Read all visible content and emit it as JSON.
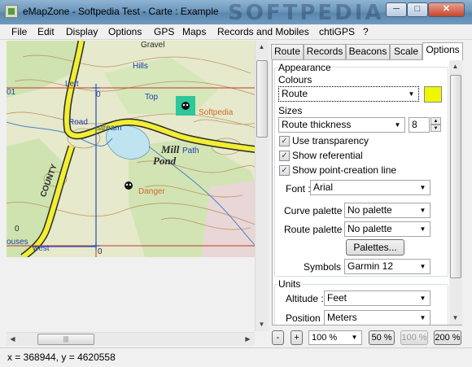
{
  "window": {
    "title": "eMapZone - Softpedia Test - Carte : Example",
    "watermark": "SOFTPEDIA"
  },
  "menu": [
    "File",
    "Edit",
    "Display",
    "Options",
    "GPS",
    "Maps",
    "Records and Mobiles",
    "chtiGPS",
    "?"
  ],
  "map": {
    "labels": {
      "gravel": "Gravel",
      "hills": "Hills",
      "left": "Left",
      "top": "Top",
      "road": "Road",
      "stream": "stream",
      "path": "Path",
      "softpedia": "Softpedia",
      "danger": "Danger",
      "mill": "Mill",
      "pond": "Pond",
      "county": "COUNTY",
      "houses": "ouses",
      "west": "west",
      "row_01": "01",
      "zero_1": "0",
      "zero_2": "0",
      "zero_3": "0"
    }
  },
  "tabs": [
    "Route",
    "Records",
    "Beacons",
    "Scale",
    "Options"
  ],
  "options": {
    "appearance_title": "Appearance",
    "colours_label": "Colours",
    "colours_value": "Route",
    "colour_swatch": "#f0f500",
    "sizes_label": "Sizes",
    "sizes_value": "Route thickness",
    "thickness_value": "8",
    "use_transparency": "Use transparency",
    "show_referential": "Show referential",
    "show_point_creation_line": "Show point-creation line",
    "font_label": "Font :",
    "font_value": "Arial",
    "curve_palette_label": "Curve palette :",
    "curve_palette_value": "No palette",
    "route_palette_label": "Route palette :",
    "route_palette_value": "No palette",
    "palettes_button": "Palettes...",
    "symbols_label": "Symbols :",
    "symbols_value": "Garmin 12",
    "units_title": "Units",
    "altitude_label": "Altitude :",
    "altitude_value": "Feet",
    "position_label": "Position :",
    "position_value": "Meters"
  },
  "zoom": {
    "minus": "-",
    "plus": "+",
    "level": "100 %",
    "z50": "50 %",
    "z100": "100 %",
    "z200": "200 %"
  },
  "status": {
    "coords": "x = 368944, y = 4620558"
  }
}
